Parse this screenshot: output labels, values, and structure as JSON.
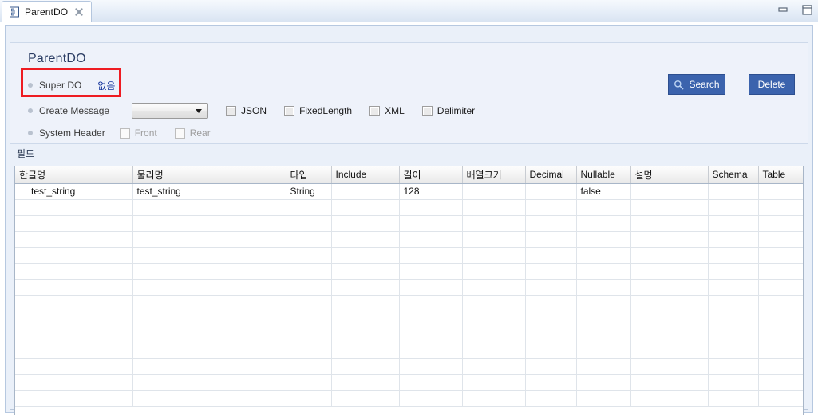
{
  "window": {
    "tab": {
      "label": "ParentDO",
      "icon": "data-object-icon",
      "close_icon": "close-icon"
    },
    "controls": {
      "minimize": "minimize-icon",
      "maximize": "maximize-icon"
    }
  },
  "form": {
    "title": "ParentDO",
    "rows": {
      "super_do": {
        "label": "Super DO",
        "value": "없음"
      },
      "create_message": {
        "label": "Create Message",
        "combo_value": "",
        "checkboxes": [
          {
            "label": "JSON",
            "checked": false,
            "enabled": true
          },
          {
            "label": "FixedLength",
            "checked": false,
            "enabled": true
          },
          {
            "label": "XML",
            "checked": false,
            "enabled": true
          },
          {
            "label": "Delimiter",
            "checked": false,
            "enabled": true
          }
        ]
      },
      "system_header": {
        "label": "System Header",
        "checkboxes": [
          {
            "label": "Front",
            "checked": false,
            "enabled": false
          },
          {
            "label": "Rear",
            "checked": false,
            "enabled": false
          }
        ]
      }
    },
    "buttons": {
      "search": "Search",
      "delete": "Delete"
    }
  },
  "field_group": {
    "legend": "필드",
    "columns": [
      {
        "key": "korean_name",
        "label": "한글명",
        "width": 147
      },
      {
        "key": "physical_name",
        "label": "물리명",
        "width": 192
      },
      {
        "key": "type",
        "label": "타입",
        "width": 57
      },
      {
        "key": "include",
        "label": "Include",
        "width": 85
      },
      {
        "key": "length",
        "label": "길이",
        "width": 79
      },
      {
        "key": "array_size",
        "label": "배열크기",
        "width": 79
      },
      {
        "key": "decimal",
        "label": "Decimal",
        "width": 64
      },
      {
        "key": "nullable",
        "label": "Nullable",
        "width": 68
      },
      {
        "key": "description",
        "label": "설명",
        "width": 97
      },
      {
        "key": "schema",
        "label": "Schema",
        "width": 63
      },
      {
        "key": "table",
        "label": "Table",
        "width": 56
      }
    ],
    "rows": [
      {
        "korean_name": "test_string",
        "physical_name": "test_string",
        "type": "String",
        "include": "",
        "length": "128",
        "array_size": "",
        "decimal": "",
        "nullable": "false",
        "description": "",
        "schema": "",
        "table": ""
      }
    ],
    "empty_row_count": 13
  },
  "colors": {
    "accent_blue": "#3b63ad",
    "link_blue": "#14349c",
    "highlight_red": "#ee1c22",
    "panel_bg": "#eef2fa",
    "outer_bg": "#eaf0f9"
  }
}
